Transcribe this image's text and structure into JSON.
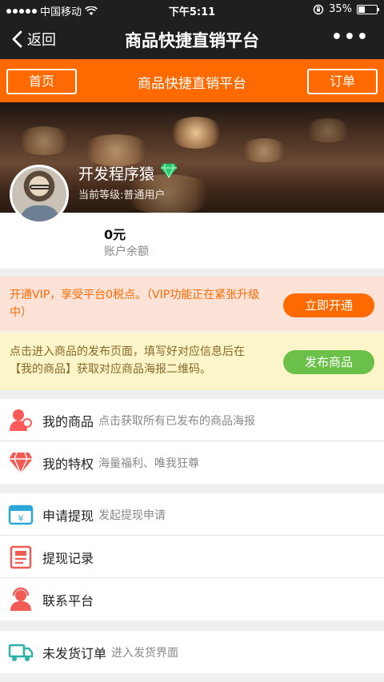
{
  "status_bar": {
    "carrier": "中国移动",
    "time": "下午5:11",
    "battery": "35%",
    "battery_level": 0.35
  },
  "nav": {
    "back_label": "返回",
    "title": "商品快捷直销平台",
    "more_label": "•••"
  },
  "header_bar": {
    "home_label": "首页",
    "title": "商品快捷直销平台",
    "order_label": "订单"
  },
  "profile": {
    "name": "开发程序猿",
    "level_text": "当前等级:普通用户",
    "balance_value": "0元",
    "balance_label": "账户余额"
  },
  "vip_panel": {
    "text": "开通VIP，享受平台0税点。（VIP功能正在紧张升级中）",
    "button": "立即开通"
  },
  "publish_panel": {
    "text": "点击进入商品的发布页面，填写好对应信息后在【我的商品】获取对应商品海报二维码。",
    "button": "发布商品"
  },
  "menu_groups": [
    [
      {
        "label": "我的商品",
        "desc": "点击获取所有已发布的商品海报",
        "icon": "user-goods-icon"
      },
      {
        "label": "我的特权",
        "desc": "海量福利、唯我狂尊",
        "icon": "diamond-privilege-icon"
      }
    ],
    [
      {
        "label": "申请提现",
        "desc": "发起提现申请",
        "icon": "wallet-icon"
      },
      {
        "label": "提现记录",
        "desc": "",
        "icon": "record-list-icon"
      },
      {
        "label": "联系平台",
        "desc": "",
        "icon": "customer-service-icon"
      }
    ],
    [
      {
        "label": "未发货订单",
        "desc": "进入发货界面",
        "icon": "delivery-truck-icon"
      }
    ]
  ]
}
